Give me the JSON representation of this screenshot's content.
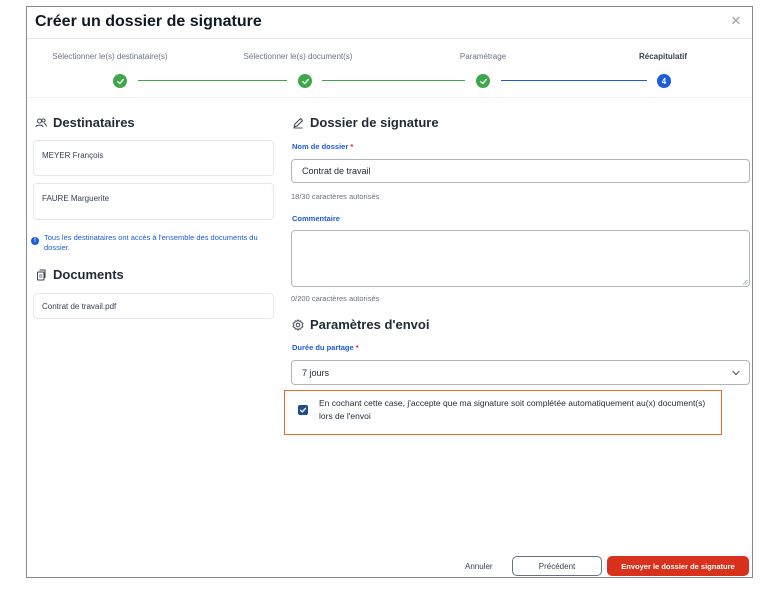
{
  "modal": {
    "title": "Créer un dossier de signature",
    "close_icon": "close-icon"
  },
  "stepper": {
    "steps": [
      {
        "label": "Sélectionner le(s) destinataire(s)",
        "state": "done"
      },
      {
        "label": "Sélectionner le(s) document(s)",
        "state": "done"
      },
      {
        "label": "Paramétrage",
        "state": "done"
      },
      {
        "label": "Récapitulatif",
        "state": "current",
        "number": "4"
      }
    ]
  },
  "recipients": {
    "title": "Destinataires",
    "icon": "users-icon",
    "items": [
      "MEYER François",
      "FAURE Marguerite"
    ],
    "info": "Tous les destinataires ont accès à l'ensemble des documents du dossier.",
    "info_icon": "info-icon"
  },
  "documents": {
    "title": "Documents",
    "icon": "documents-icon",
    "items": [
      "Contrat de travail.pdf"
    ]
  },
  "folder": {
    "title": "Dossier de signature",
    "icon": "pen-icon",
    "name_label": "Nom de dossier",
    "name_value": "Contrat de travail",
    "name_helper": "18/30 caractères autorisés",
    "comment_label": "Commentaire",
    "comment_value": "",
    "comment_helper": "0/200 caractères autorisés"
  },
  "sending": {
    "title": "Paramètres d'envoi",
    "icon": "gear-icon",
    "duration_label": "Durée du partage",
    "duration_value": "7 jours",
    "consent_text": "En cochant cette case, j'accepte que ma signature soit complétée automatiquement au(x) document(s) lors de l'envoi",
    "consent_checked": true
  },
  "required_mark": "*",
  "footer": {
    "cancel_label": "Annuler",
    "previous_label": "Précédent",
    "submit_label": "Envoyer le dossier de signature"
  },
  "colors": {
    "primary_blue": "#1d5bd8",
    "success_green": "#3fa64a",
    "danger_red": "#d8321c",
    "annotation_orange": "#f06a25",
    "annotation_yellow": "#fff200"
  }
}
